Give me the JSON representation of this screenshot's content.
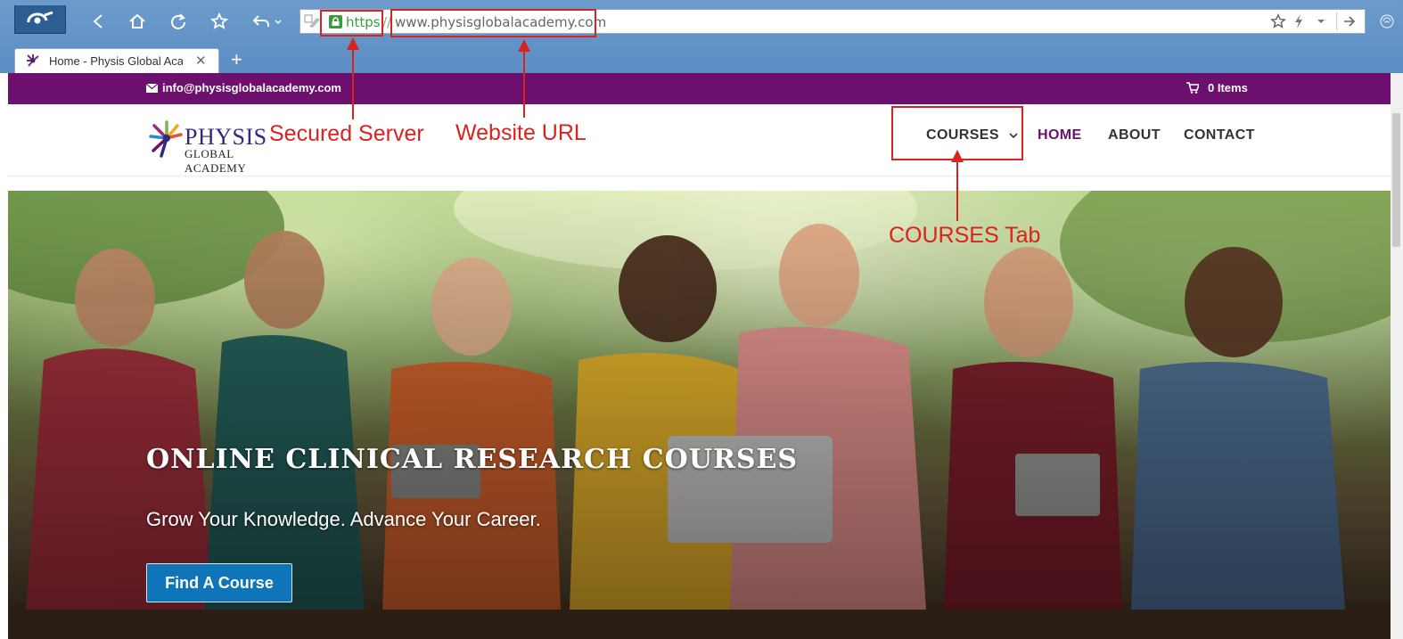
{
  "browser": {
    "tab_title": "Home - Physis Global Aca",
    "address": {
      "scheme": "https",
      "separator": "//",
      "url": "www.physisglobalacademy.com"
    }
  },
  "site": {
    "topbar": {
      "email": "info@physisglobalacademy.com",
      "cart": "0 Items"
    },
    "logo": {
      "word": "PHYSIS",
      "sub": "GLOBAL ACADEMY"
    },
    "nav": {
      "courses": "COURSES",
      "home": "HOME",
      "about": "ABOUT",
      "contact": "CONTACT"
    },
    "hero": {
      "title": "ONLINE CLINICAL RESEARCH COURSES",
      "subtitle": "Grow Your Knowledge. Advance Your Career.",
      "button": "Find A Course"
    }
  },
  "annotations": {
    "secured_server": "Secured Server",
    "website_url": "Website URL",
    "courses_tab": "COURSES Tab"
  },
  "colors": {
    "brand_purple": "#6d0f6c",
    "button_blue": "#0f74b8",
    "annotation_red": "#d9231e",
    "secure_green": "#3c9b3c"
  }
}
